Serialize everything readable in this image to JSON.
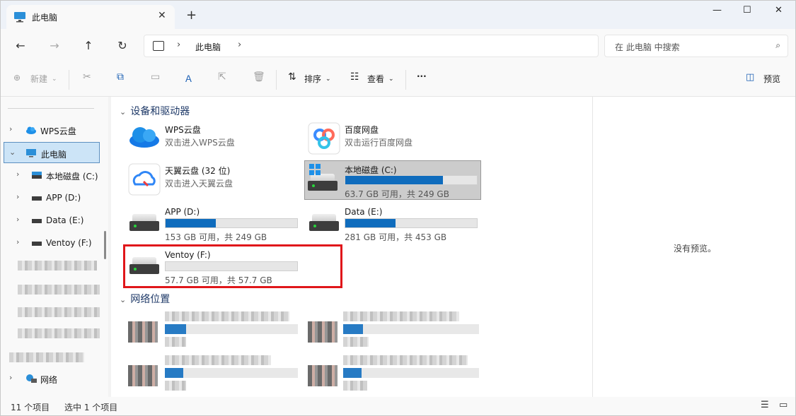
{
  "tab": {
    "title": "此电脑",
    "close": "✕",
    "new": "+"
  },
  "window": {
    "minimize": "—",
    "maximize": "☐",
    "close": "✕"
  },
  "nav": {
    "back": "←",
    "forward": "→",
    "up": "↑",
    "refresh": "↻",
    "sep": "›",
    "crumb": "此电脑",
    "search_placeholder": "在 此电脑 中搜索",
    "search_icon": "⌕"
  },
  "toolbar": {
    "new_label": "新建",
    "sort_label": "排序",
    "view_label": "查看",
    "more": "···",
    "preview_label": "预览"
  },
  "sidebar": {
    "items": [
      {
        "label": "WPS云盘"
      },
      {
        "label": "此电脑"
      },
      {
        "label": "本地磁盘 (C:)"
      },
      {
        "label": "APP (D:)"
      },
      {
        "label": "Data (E:)"
      },
      {
        "label": "Ventoy (F:)"
      },
      {
        "label": "网络"
      }
    ]
  },
  "content": {
    "section_devices": "设备和驱动器",
    "section_network": "网络位置",
    "wps": {
      "name": "WPS云盘",
      "sub": "双击进入WPS云盘"
    },
    "baidu": {
      "name": "百度网盘",
      "sub": "双击运行百度网盘"
    },
    "tianyi": {
      "name": "天翼云盘 (32 位)",
      "sub": "双击进入天翼云盘"
    },
    "drives": [
      {
        "name": "本地磁盘 (C:)",
        "caption": "63.7 GB 可用，共 249 GB",
        "used_fraction": 0.74
      },
      {
        "name": "APP (D:)",
        "caption": "153 GB 可用，共 249 GB",
        "used_fraction": 0.38
      },
      {
        "name": "Data (E:)",
        "caption": "281 GB 可用，共 453 GB",
        "used_fraction": 0.38
      },
      {
        "name": "Ventoy (F:)",
        "caption": "57.7 GB 可用，共 57.7 GB",
        "used_fraction": 0.0
      }
    ]
  },
  "preview": {
    "message": "没有预览。"
  },
  "status": {
    "count": "11 个项目",
    "selected": "选中 1 个项目"
  },
  "colors": {
    "accent": "#0f6cbd",
    "highlight": "#e0161a",
    "selection": "#cce4f7"
  }
}
